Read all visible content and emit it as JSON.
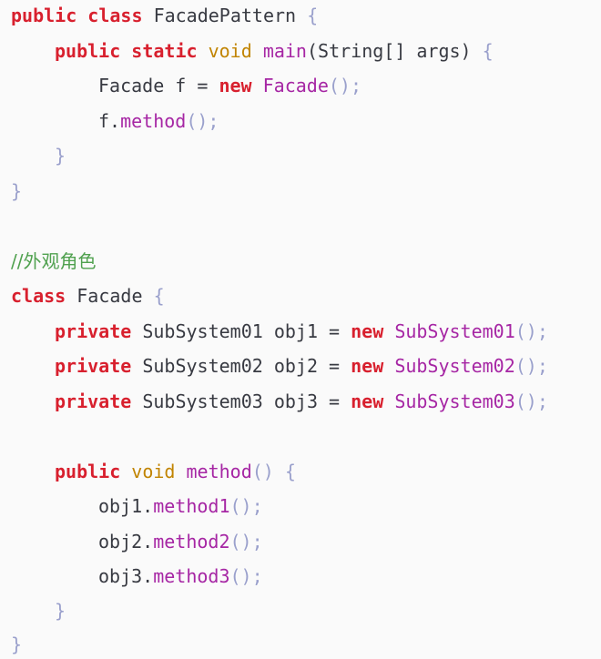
{
  "code": {
    "l1": {
      "kw1": "public",
      "kw2": "class",
      "name": "FacadePattern",
      "brace": "{"
    },
    "l2": {
      "kw1": "public",
      "kw2": "static",
      "type": "void",
      "fn": "main",
      "args": "(String[] args)",
      "brace": "{"
    },
    "l3": {
      "decl": "Facade f",
      "eq": "=",
      "kw": "new",
      "cls": "Facade",
      "call": "();"
    },
    "l4": {
      "obj": "f.",
      "fn": "method",
      "call": "();"
    },
    "l5": {
      "brace": "}"
    },
    "l6": {
      "brace": "}"
    },
    "l7": {
      "comment": "//外观角色"
    },
    "l8": {
      "kw": "class",
      "name": "Facade",
      "brace": "{"
    },
    "l9": {
      "kw": "private",
      "decl": "SubSystem01 obj1",
      "eq": "=",
      "kw2": "new",
      "cls": "SubSystem01",
      "call": "();"
    },
    "l10": {
      "kw": "private",
      "decl": "SubSystem02 obj2",
      "eq": "=",
      "kw2": "new",
      "cls": "SubSystem02",
      "call": "();"
    },
    "l11": {
      "kw": "private",
      "decl": "SubSystem03 obj3",
      "eq": "=",
      "kw2": "new",
      "cls": "SubSystem03",
      "call": "();"
    },
    "l12": {
      "kw": "public",
      "type": "void",
      "fn": "method",
      "call": "()",
      "brace": "{"
    },
    "l13": {
      "obj": "obj1.",
      "fn": "method1",
      "call": "();"
    },
    "l14": {
      "obj": "obj2.",
      "fn": "method2",
      "call": "();"
    },
    "l15": {
      "obj": "obj3.",
      "fn": "method3",
      "call": "();"
    },
    "l16": {
      "brace": "}"
    },
    "l17": {
      "brace": "}"
    }
  }
}
